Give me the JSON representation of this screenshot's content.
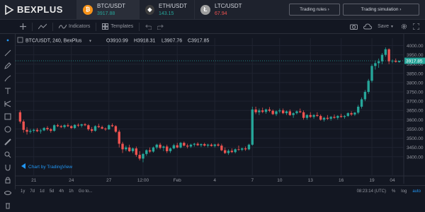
{
  "app": {
    "brand": "BEXPLUS"
  },
  "tickers": [
    {
      "symbol": "BTC/USDT",
      "price": "3917.88",
      "dir": "up",
      "coin": "bitcoin-icon",
      "glyph": "₿",
      "color": "#f7931a"
    },
    {
      "symbol": "ETH/USDT",
      "price": "143.15",
      "dir": "up",
      "coin": "ethereum-icon",
      "glyph": "◆",
      "color": "#3c3c3d"
    },
    {
      "symbol": "LTC/USDT",
      "price": "67.94",
      "dir": "down",
      "coin": "litecoin-icon",
      "glyph": "Ł",
      "color": "#9e9e9e"
    }
  ],
  "buttons": {
    "trading_rules": "Trading rules ›",
    "trading_sim": "Trading simulation ›"
  },
  "toolbar": {
    "indicators": "Indicators",
    "templates": "Templates",
    "save": "Save"
  },
  "legend": {
    "symbol": "BTC/USDT, 240, BexPlus",
    "open": "O3910.99",
    "high": "H3918.31",
    "low": "L3907.76",
    "close": "C3917.85"
  },
  "last_price_label": "3917.85",
  "watermark": "Chart by TradingView",
  "bottom": {
    "ranges": [
      "1y",
      "7d",
      "1d",
      "5d",
      "4h",
      "1h",
      "Go to..."
    ],
    "time": "08:23:14 (UTC)",
    "percent": "%",
    "log": "log",
    "auto": "auto"
  },
  "colors": {
    "up": "#26a69a",
    "down": "#ef5350",
    "bg": "#131722"
  },
  "chart_data": {
    "type": "candlestick",
    "title": "BTC/USDT, 240, BexPlus",
    "ylim": [
      3300,
      4040
    ],
    "yticks": [
      3400,
      3450,
      3500,
      3550,
      3600,
      3650,
      3700,
      3750,
      3800,
      3850,
      3900,
      3950,
      4000
    ],
    "xticks": [
      "21",
      "24",
      "27",
      "12:00",
      "Feb",
      "4",
      "7",
      "10",
      "13",
      "16",
      "19",
      "04"
    ],
    "n_candles": 112,
    "candles": [
      [
        3640,
        3650,
        3580,
        3590
      ],
      [
        3590,
        3600,
        3530,
        3545
      ],
      [
        3545,
        3560,
        3520,
        3535
      ],
      [
        3535,
        3550,
        3525,
        3540
      ],
      [
        3540,
        3552,
        3530,
        3545
      ],
      [
        3545,
        3555,
        3532,
        3538
      ],
      [
        3538,
        3550,
        3525,
        3542
      ],
      [
        3542,
        3560,
        3538,
        3555
      ],
      [
        3555,
        3565,
        3540,
        3548
      ],
      [
        3548,
        3555,
        3530,
        3540
      ],
      [
        3540,
        3575,
        3535,
        3570
      ],
      [
        3570,
        3578,
        3560,
        3565
      ],
      [
        3565,
        3572,
        3555,
        3560
      ],
      [
        3560,
        3575,
        3552,
        3570
      ],
      [
        3570,
        3580,
        3560,
        3565
      ],
      [
        3565,
        3570,
        3550,
        3555
      ],
      [
        3555,
        3575,
        3550,
        3572
      ],
      [
        3572,
        3580,
        3560,
        3568
      ],
      [
        3568,
        3578,
        3558,
        3575
      ],
      [
        3575,
        3582,
        3565,
        3570
      ],
      [
        3570,
        3576,
        3540,
        3548
      ],
      [
        3548,
        3560,
        3530,
        3540
      ],
      [
        3540,
        3570,
        3535,
        3565
      ],
      [
        3565,
        3578,
        3555,
        3560
      ],
      [
        3560,
        3568,
        3548,
        3552
      ],
      [
        3552,
        3558,
        3540,
        3548
      ],
      [
        3548,
        3575,
        3545,
        3570
      ],
      [
        3570,
        3580,
        3560,
        3565
      ],
      [
        3565,
        3570,
        3530,
        3535
      ],
      [
        3535,
        3545,
        3450,
        3470
      ],
      [
        3470,
        3480,
        3420,
        3440
      ],
      [
        3440,
        3460,
        3430,
        3450
      ],
      [
        3450,
        3465,
        3425,
        3430
      ],
      [
        3430,
        3450,
        3420,
        3445
      ],
      [
        3445,
        3455,
        3400,
        3410
      ],
      [
        3410,
        3430,
        3380,
        3390
      ],
      [
        3390,
        3420,
        3370,
        3415
      ],
      [
        3415,
        3440,
        3405,
        3435
      ],
      [
        3435,
        3450,
        3420,
        3428
      ],
      [
        3428,
        3455,
        3422,
        3450
      ],
      [
        3450,
        3470,
        3440,
        3465
      ],
      [
        3465,
        3475,
        3440,
        3448
      ],
      [
        3448,
        3460,
        3430,
        3455
      ],
      [
        3455,
        3465,
        3420,
        3430
      ],
      [
        3430,
        3450,
        3420,
        3445
      ],
      [
        3445,
        3470,
        3440,
        3462
      ],
      [
        3462,
        3475,
        3445,
        3450
      ],
      [
        3450,
        3480,
        3445,
        3475
      ],
      [
        3475,
        3482,
        3455,
        3460
      ],
      [
        3460,
        3470,
        3445,
        3455
      ],
      [
        3455,
        3470,
        3448,
        3465
      ],
      [
        3465,
        3475,
        3455,
        3470
      ],
      [
        3470,
        3478,
        3458,
        3462
      ],
      [
        3462,
        3472,
        3452,
        3468
      ],
      [
        3468,
        3475,
        3455,
        3460
      ],
      [
        3460,
        3470,
        3450,
        3465
      ],
      [
        3465,
        3472,
        3455,
        3458
      ],
      [
        3458,
        3470,
        3450,
        3466
      ],
      [
        3466,
        3474,
        3455,
        3460
      ],
      [
        3460,
        3470,
        3430,
        3435
      ],
      [
        3435,
        3450,
        3415,
        3420
      ],
      [
        3420,
        3440,
        3410,
        3432
      ],
      [
        3432,
        3445,
        3420,
        3425
      ],
      [
        3425,
        3445,
        3418,
        3440
      ],
      [
        3440,
        3460,
        3432,
        3438
      ],
      [
        3438,
        3450,
        3430,
        3445
      ],
      [
        3445,
        3455,
        3432,
        3440
      ],
      [
        3440,
        3470,
        3435,
        3465
      ],
      [
        3465,
        3670,
        3460,
        3655
      ],
      [
        3655,
        3670,
        3630,
        3640
      ],
      [
        3640,
        3660,
        3625,
        3650
      ],
      [
        3650,
        3665,
        3635,
        3642
      ],
      [
        3642,
        3660,
        3632,
        3655
      ],
      [
        3655,
        3668,
        3640,
        3648
      ],
      [
        3648,
        3655,
        3625,
        3630
      ],
      [
        3630,
        3650,
        3620,
        3645
      ],
      [
        3645,
        3660,
        3635,
        3650
      ],
      [
        3650,
        3660,
        3630,
        3635
      ],
      [
        3635,
        3650,
        3625,
        3645
      ],
      [
        3645,
        3655,
        3620,
        3625
      ],
      [
        3625,
        3640,
        3610,
        3635
      ],
      [
        3635,
        3650,
        3628,
        3645
      ],
      [
        3645,
        3660,
        3635,
        3640
      ],
      [
        3640,
        3650,
        3600,
        3610
      ],
      [
        3610,
        3630,
        3600,
        3625
      ],
      [
        3625,
        3640,
        3610,
        3615
      ],
      [
        3615,
        3630,
        3605,
        3625
      ],
      [
        3625,
        3640,
        3615,
        3620
      ],
      [
        3620,
        3628,
        3595,
        3600
      ],
      [
        3600,
        3615,
        3590,
        3610
      ],
      [
        3610,
        3625,
        3598,
        3605
      ],
      [
        3605,
        3620,
        3595,
        3615
      ],
      [
        3615,
        3628,
        3605,
        3610
      ],
      [
        3610,
        3625,
        3600,
        3620
      ],
      [
        3620,
        3632,
        3610,
        3615
      ],
      [
        3615,
        3625,
        3605,
        3620
      ],
      [
        3620,
        3640,
        3615,
        3635
      ],
      [
        3635,
        3645,
        3620,
        3628
      ],
      [
        3628,
        3642,
        3620,
        3638
      ],
      [
        3638,
        3680,
        3630,
        3670
      ],
      [
        3670,
        3720,
        3660,
        3710
      ],
      [
        3710,
        3760,
        3700,
        3750
      ],
      [
        3750,
        3820,
        3740,
        3810
      ],
      [
        3810,
        3900,
        3800,
        3890
      ],
      [
        3890,
        3920,
        3870,
        3905
      ],
      [
        3905,
        3930,
        3880,
        3915
      ],
      [
        3915,
        3960,
        3900,
        3950
      ],
      [
        3950,
        3990,
        3940,
        3980
      ],
      [
        3980,
        3985,
        3900,
        3915
      ],
      [
        3915,
        3925,
        3905,
        3918
      ],
      [
        3918,
        3930,
        3908,
        3912
      ],
      [
        3910.99,
        3918.31,
        3907.76,
        3917.85
      ]
    ]
  }
}
